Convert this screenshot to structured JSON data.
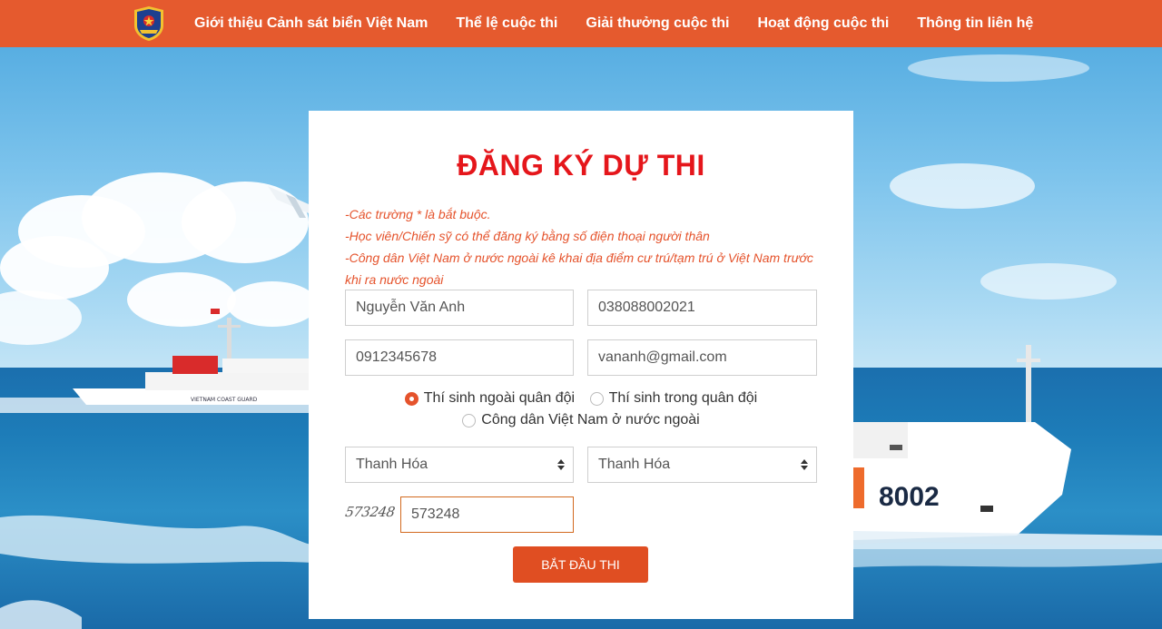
{
  "nav": {
    "items": [
      {
        "label": "Giới thiệu Cảnh sát biển Việt Nam"
      },
      {
        "label": "Thể lệ cuộc thi"
      },
      {
        "label": "Giải thưởng cuộc thi"
      },
      {
        "label": "Hoạt động cuộc thi"
      },
      {
        "label": "Thông tin liên hệ"
      }
    ]
  },
  "colors": {
    "nav_bg": "#e55a2e",
    "title": "#e5161b",
    "notes": "#e5532c",
    "button": "#e04e22"
  },
  "form": {
    "title": "ĐĂNG KÝ DỰ THI",
    "notes": [
      "-Các trường * là bắt buộc.",
      "-Học viên/Chiến sỹ có thể đăng ký bằng số điện thoại người thân",
      "-Công dân Việt Nam ở nước ngoài kê khai địa điểm cư trú/tạm trú ở Việt Nam trước khi ra nước ngoài"
    ],
    "fullname": "Nguyễn Văn Anh",
    "id_number": "038088002021",
    "phone": "0912345678",
    "email": "vananh@gmail.com",
    "radios": [
      {
        "label": "Thí sinh ngoài quân đội",
        "checked": true
      },
      {
        "label": "Thí sinh trong quân đội",
        "checked": false
      },
      {
        "label": "Công dân Việt Nam ở nước ngoài",
        "checked": false
      }
    ],
    "province": "Thanh Hóa",
    "district": "Thanh Hóa",
    "captcha_image_text": "573248",
    "captcha_value": "573248",
    "submit_label": "BẮT ĐẦU THI"
  },
  "ship_left_text": "VIETNAM COAST GUARD",
  "ship_right_number": "8002"
}
